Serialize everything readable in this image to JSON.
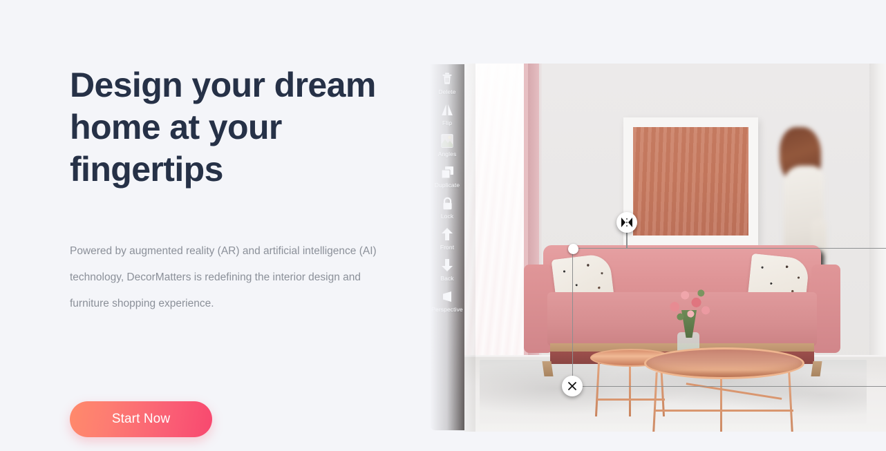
{
  "hero": {
    "headline": "Design your dream home at your fingertips",
    "subcopy": "Powered by augmented reality (AR) and artificial intelligence (AI) technology, DecorMatters is redefining the interior design and furniture shopping experience.",
    "cta_label": "Start Now",
    "colors": {
      "page_background": "#f4f5f9",
      "headline": "#263147",
      "body_text": "#8b9099",
      "cta_gradient_start": "#ff8a6b",
      "cta_gradient_end": "#f8486f",
      "cta_text": "#ffffff"
    }
  },
  "ar_preview": {
    "toolbar": {
      "background_top": "#6e6b6b",
      "background_bottom": "#2c2523",
      "items": [
        {
          "label": "Delete",
          "icon": "trash-icon"
        },
        {
          "label": "Flip",
          "icon": "flip-icon"
        },
        {
          "label": "Angles",
          "icon": "angles-icon"
        },
        {
          "label": "Duplicate",
          "icon": "duplicate-icon"
        },
        {
          "label": "Lock",
          "icon": "lock-icon"
        },
        {
          "label": "Front",
          "icon": "arrow-up-icon"
        },
        {
          "label": "Back",
          "icon": "arrow-down-icon"
        },
        {
          "label": "Perspective",
          "icon": "perspective-icon"
        }
      ]
    },
    "selection": {
      "handle_count": 4,
      "border_color": "#8d8f90",
      "flip_button_icon": "mirror-flip-icon",
      "close_button_icon": "close-icon"
    },
    "scene": {
      "description": "Living room with pink velvet sofa, terrazzo cushions, rose gold round coffee tables, flowers, framed terracotta artwork, pink and sheer curtains, grey rug and a blurred person walking."
    }
  }
}
